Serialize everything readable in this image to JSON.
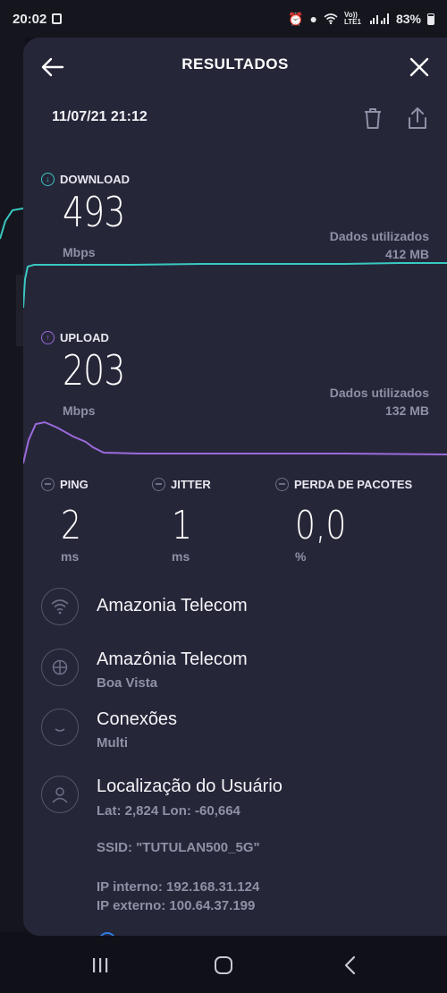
{
  "status_bar": {
    "time": "20:02",
    "network": "Vo)) LTE1",
    "battery": "83%"
  },
  "header": {
    "title": "RESULTADOS"
  },
  "result": {
    "date": "11/07/21 21:12"
  },
  "download": {
    "label": "DOWNLOAD",
    "value": "493",
    "unit": "Mbps",
    "data_used_label": "Dados utilizados",
    "data_used": "412 MB",
    "color": "#39c9c1"
  },
  "upload": {
    "label": "UPLOAD",
    "value": "203",
    "unit": "Mbps",
    "data_used_label": "Dados utilizados",
    "data_used": "132 MB",
    "color": "#9b6bdb"
  },
  "stats": {
    "ping": {
      "label": "PING",
      "value": "2",
      "unit": "ms"
    },
    "jitter": {
      "label": "JITTER",
      "value": "1",
      "unit": "ms"
    },
    "loss": {
      "label": "PERDA DE PACOTES",
      "value": "0,0",
      "unit": "%"
    }
  },
  "info": {
    "provider": {
      "title": "Amazonia Telecom",
      "icon": "wifi-icon"
    },
    "server": {
      "title": "Amazônia Telecom",
      "subtitle": "Boa Vista",
      "icon": "globe-icon"
    },
    "connections": {
      "title": "Conexões",
      "subtitle": "Multi",
      "icon": "connections-icon"
    },
    "location": {
      "title": "Localização do Usuário",
      "coords": "Lat: 2,824 Lon: -60,664",
      "ssid": "SSID: \"TUTULAN500_5G\"",
      "ip_internal": "IP interno: 192.168.31.124",
      "ip_external": "IP externo: 100.64.37.199",
      "icon": "user-icon"
    }
  },
  "nav": {
    "recents": "recents-icon",
    "home": "home-icon",
    "back": "back-icon"
  }
}
